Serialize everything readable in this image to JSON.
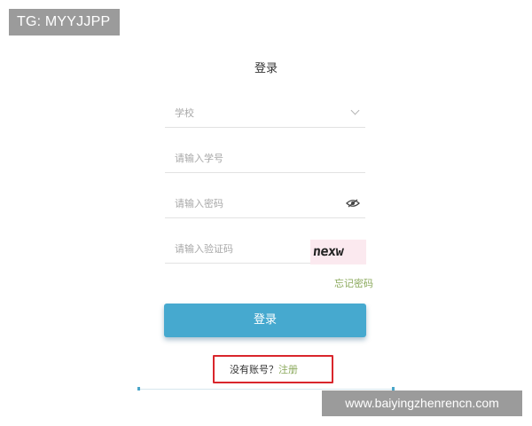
{
  "overlay": {
    "tg_badge": "TG: MYYJJPP",
    "watermark": "www.baiyingzhenrencn.com"
  },
  "login": {
    "title": "登录",
    "school_placeholder": "学校",
    "student_id_placeholder": "请输入学号",
    "password_placeholder": "请输入密码",
    "captcha_placeholder": "请输入验证码",
    "captcha_text": "nexw",
    "forgot_password": "忘记密码",
    "login_button": "登录",
    "no_account": "没有账号？",
    "register": "注册"
  },
  "icons": {
    "school_dropdown": "chevron-down-icon",
    "password_toggle": "eye-icon"
  },
  "colors": {
    "primary_button": "#46a9cf",
    "link_green": "#8ba95c",
    "highlight_red": "#d9262c",
    "overlay_gray": "#9b9b9b"
  }
}
